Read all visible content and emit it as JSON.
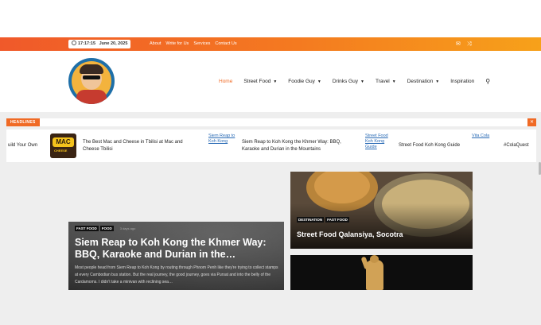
{
  "topbar": {
    "time": "17:17:15",
    "date": "June 20, 2025",
    "links": [
      "About",
      "Write for Us",
      "Services",
      "Contact Us"
    ],
    "icons": [
      "mail-icon",
      "shuffle-icon"
    ]
  },
  "nav": {
    "items": [
      {
        "label": "Home",
        "dropdown": false,
        "active": true
      },
      {
        "label": "Street Food",
        "dropdown": true
      },
      {
        "label": "Foodie Guy",
        "dropdown": true
      },
      {
        "label": "Drinks Guy",
        "dropdown": true
      },
      {
        "label": "Travel",
        "dropdown": true
      },
      {
        "label": "Destination",
        "dropdown": true
      },
      {
        "label": "Inspiration",
        "dropdown": false
      }
    ],
    "search_icon": "search-icon"
  },
  "headlines": {
    "tag": "HEADLINES",
    "close_icon": "close-icon",
    "items": [
      {
        "text": "uild Your Own"
      },
      {
        "thumb_top": "MAC",
        "thumb_bottom": "CHEESE",
        "text": "The Best Mac and Cheese in Tbilisi at Mac and Cheese Tbilisi"
      },
      {
        "alt": "Siem Reap to Koh Kong",
        "text": "Siem Reap to Koh Kong the Khmer Way: BBQ, Karaoke and Durian in the Mountains"
      },
      {
        "alt": "Street Food Koh Kong Guide",
        "text": "Street Food Koh Kong Guide"
      },
      {
        "alt": "Vita Cola",
        "text": "#ColaQuest"
      }
    ]
  },
  "hero": {
    "categories": [
      "FAST FOOD",
      "FOOD"
    ],
    "meta": "3 days ago",
    "title": "Siem Reap to Koh Kong the Khmer Way: BBQ, Karaoke and Durian in the…",
    "excerpt": "Most people head from Siem Reap to Koh Kong by routing through Phnom Penh like they're trying to collect stamps at every Cambodian bus station. But the real journey, the good journey, goes via Pursat and into the belly of the Cardamoms. I didn't take a minivan with reclining sea…"
  },
  "card1": {
    "categories": [
      "DESTINATION",
      "FAST FOOD"
    ],
    "title": "Street Food Qalansiya, Socotra"
  },
  "colors": {
    "accent": "#f06a25",
    "topbar_start": "#f0592a",
    "topbar_end": "#f7a11a"
  }
}
